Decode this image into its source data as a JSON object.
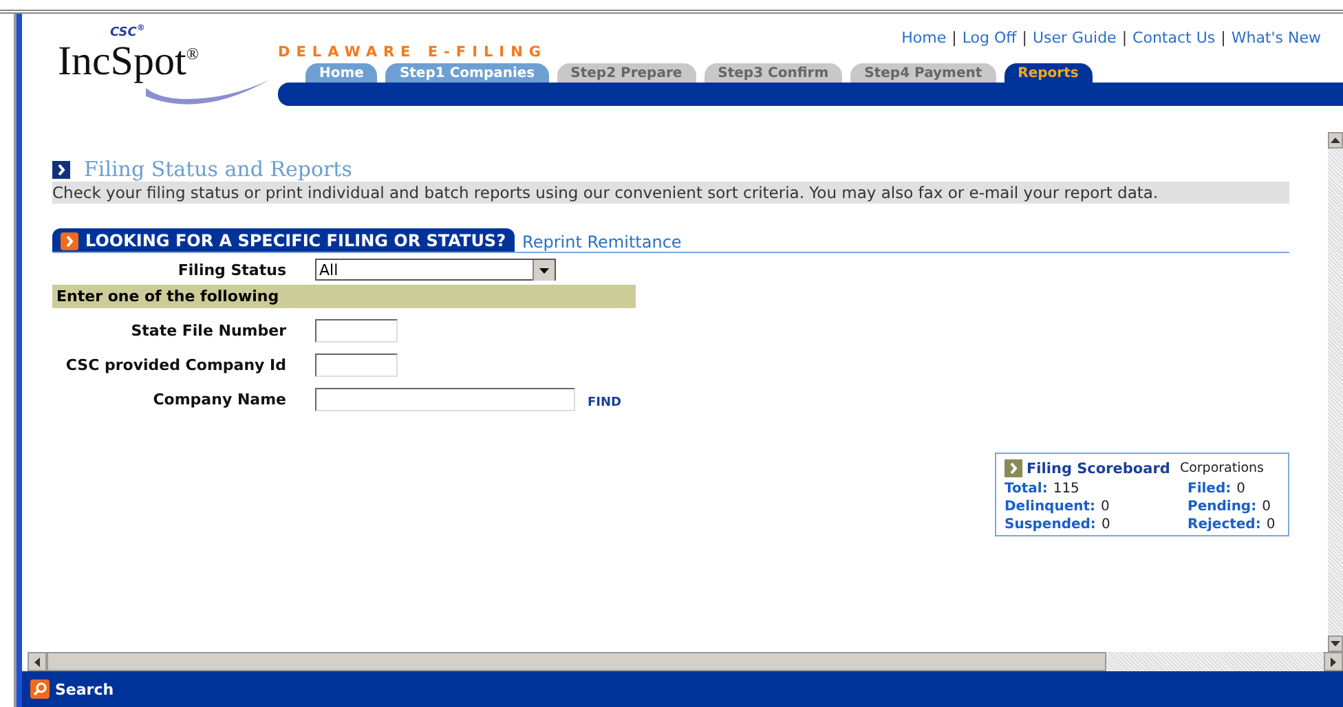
{
  "logo": {
    "small": "CSC",
    "name": "IncSpot",
    "mark": "®",
    "small_mark": "®"
  },
  "site_title": "DELAWARE E-FILING",
  "top_links": [
    "Home",
    "Log Off",
    "User Guide",
    "Contact Us",
    "What's New"
  ],
  "link_separator": "|",
  "tabs": [
    {
      "label": "Home",
      "enabled": true,
      "selected": false
    },
    {
      "label": "Step1  Companies",
      "enabled": true,
      "selected": false
    },
    {
      "label": "Step2 Prepare",
      "enabled": false,
      "selected": false
    },
    {
      "label": "Step3 Confirm",
      "enabled": false,
      "selected": false
    },
    {
      "label": "Step4 Payment",
      "enabled": false,
      "selected": false
    },
    {
      "label": "Reports",
      "enabled": true,
      "selected": true
    }
  ],
  "page_title": "Filing Status and Reports",
  "intro": "Check your filing status or print individual and batch reports using our convenient sort criteria. You may also fax or e-mail your report data.",
  "section_tabs": [
    {
      "label": "LOOKING FOR A SPECIFIC FILING OR STATUS?",
      "selected": true
    },
    {
      "label": "Reprint Remittance",
      "selected": false
    }
  ],
  "filing_status": {
    "label": "Filing Status",
    "value": "All"
  },
  "group_heading": "Enter one of the following",
  "fields": [
    {
      "label": "State File Number",
      "kind": "short"
    },
    {
      "label": "CSC provided Company Id",
      "kind": "short"
    },
    {
      "label": "Company Name",
      "kind": "long",
      "action": "FIND"
    }
  ],
  "scoreboard": {
    "title": "Filing Scoreboard",
    "scope": "Corporations",
    "items": [
      {
        "label": "Total:",
        "value": "115"
      },
      {
        "label": "Filed:",
        "value": "0"
      },
      {
        "label": "Delinquent:",
        "value": "0"
      },
      {
        "label": "Pending:",
        "value": "0"
      },
      {
        "label": "Suspended:",
        "value": "0"
      },
      {
        "label": "Rejected:",
        "value": "0"
      }
    ]
  },
  "bottom_bar": {
    "label": "Search"
  }
}
